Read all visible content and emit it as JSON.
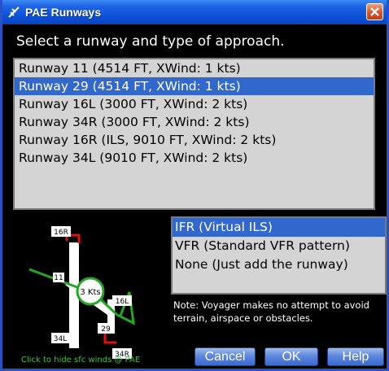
{
  "window": {
    "title": "PAE Runways",
    "title_icon": "airplane-icon",
    "close_icon": "close-icon"
  },
  "prompt": "Select a runway and type of approach.",
  "runways": [
    {
      "label": "Runway 11  (4514 FT, XWind: 1 kts)",
      "selected": false
    },
    {
      "label": "Runway 29  (4514 FT, XWind: 1 kts)",
      "selected": true
    },
    {
      "label": "Runway 16L  (3000 FT, XWind: 2 kts)",
      "selected": false
    },
    {
      "label": "Runway 34R  (3000 FT, XWind: 2 kts)",
      "selected": false
    },
    {
      "label": "Runway 16R  (ILS, 9010 FT, XWind: 2 kts)",
      "selected": false
    },
    {
      "label": "Runway 34L  (9010 FT, XWind: 2 kts)",
      "selected": false
    }
  ],
  "map": {
    "labels": {
      "r16R": "16R",
      "r11": "11",
      "r16L": "16L",
      "r29": "29",
      "r34L": "34L",
      "r34R": "34R"
    },
    "wind": "3 Kts",
    "caption": "Click to hide sfc winds @ PAE"
  },
  "approaches": [
    {
      "label": "IFR (Virtual ILS)",
      "selected": true
    },
    {
      "label": "VFR (Standard VFR pattern)",
      "selected": false
    },
    {
      "label": "None (Just add the runway)",
      "selected": false
    }
  ],
  "note": "Note:  Voyager makes no attempt to avoid terrain, airspace or obstacles.",
  "buttons": {
    "cancel": "Cancel",
    "ok": "OK",
    "help": "Help"
  },
  "colors": {
    "titlebar": "#0b4fd6",
    "selection": "#3267cc",
    "list_bg": "#d4d4d4",
    "wind_green": "#22a822",
    "runway_red": "#e01010"
  }
}
